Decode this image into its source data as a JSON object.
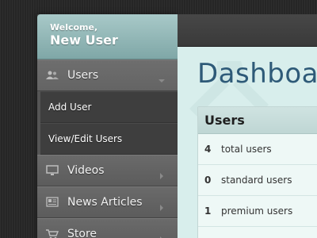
{
  "welcome": {
    "greeting": "Welcome,",
    "name": "New User"
  },
  "nav": {
    "users": {
      "label": "Users"
    },
    "users_sub": [
      {
        "label": "Add User"
      },
      {
        "label": "View/Edit Users"
      }
    ],
    "videos": {
      "label": "Videos"
    },
    "news": {
      "label": "News Articles"
    },
    "store": {
      "label": "Store"
    }
  },
  "main": {
    "title": "Dashboard",
    "panel": {
      "title": "Users",
      "rows": [
        {
          "count": "4",
          "label": "total users"
        },
        {
          "count": "0",
          "label": "standard users"
        },
        {
          "count": "1",
          "label": "premium users"
        }
      ]
    }
  },
  "colors": {
    "accent_teal": "#8fb5b4",
    "title_blue": "#2e5a78",
    "content_bg": "#d8eeec"
  }
}
